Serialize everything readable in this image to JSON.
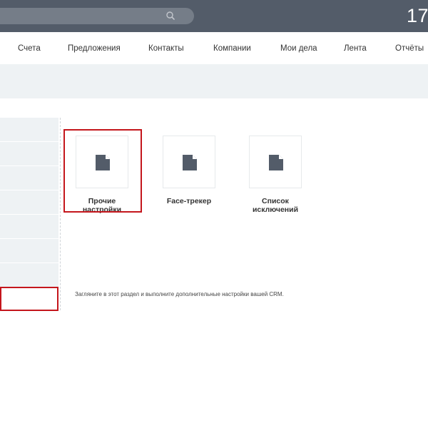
{
  "header": {
    "search_placeholder": "",
    "clock": "17"
  },
  "menu": {
    "items": [
      "Счета",
      "Предложения",
      "Контакты",
      "Компании",
      "Мои дела",
      "Лента",
      "Отчёты"
    ]
  },
  "tiles": [
    {
      "label": "Прочие настройки",
      "icon": "document-icon",
      "highlighted": true
    },
    {
      "label": "Face-трекер",
      "icon": "document-icon",
      "highlighted": false
    },
    {
      "label": "Список исключений",
      "icon": "document-icon",
      "highlighted": false
    }
  ],
  "hint": "Загляните в этот раздел и выполните дополнительные настройки вашей CRM.",
  "colors": {
    "header_bg": "#535c69",
    "highlight": "#c4161c",
    "icon": "#535c69"
  }
}
